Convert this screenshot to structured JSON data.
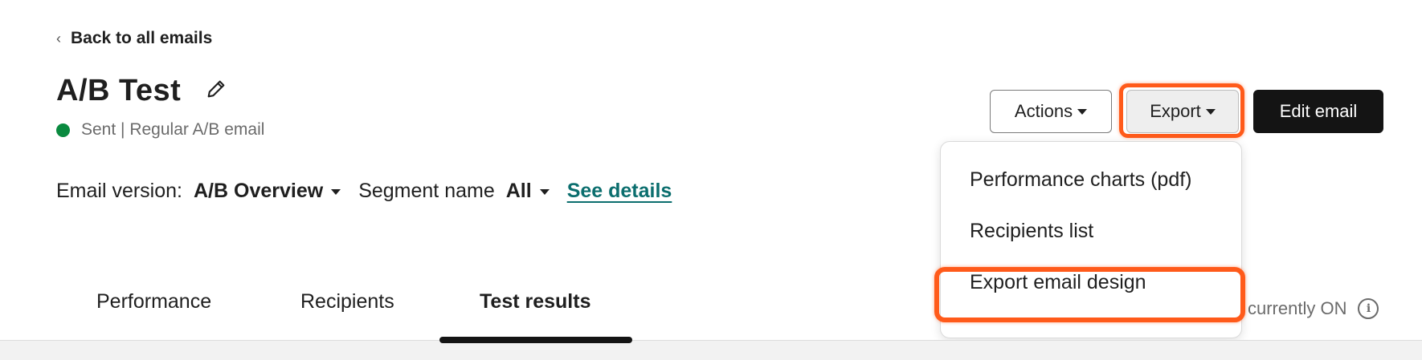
{
  "nav": {
    "back_label": "Back to all emails",
    "back_icon": "chevron-left-icon"
  },
  "header": {
    "title": "A/B Test",
    "edit_icon": "pencil-icon",
    "status_color": "#0a8a3f",
    "status_text": "Sent | Regular A/B email"
  },
  "filters": {
    "version_label": "Email version:",
    "version_value": "A/B Overview",
    "segment_label": "Segment name",
    "segment_value": "All",
    "details_link": "See details"
  },
  "toolbar": {
    "actions_label": "Actions",
    "export_label": "Export",
    "edit_label": "Edit email"
  },
  "export_menu": {
    "items": [
      {
        "label": "Performance charts (pdf)"
      },
      {
        "label": "Recipients list"
      },
      {
        "label": "Export email design"
      }
    ],
    "highlight_color": "#ff5a1a"
  },
  "tabs": [
    {
      "label": "Performance"
    },
    {
      "label": "Recipients"
    },
    {
      "label": "Test results",
      "active": true
    }
  ],
  "ab_status": {
    "text": "currently ON",
    "icon": "info-icon"
  },
  "colors": {
    "link": "#0b6e6e",
    "primary_button": "#141414"
  }
}
